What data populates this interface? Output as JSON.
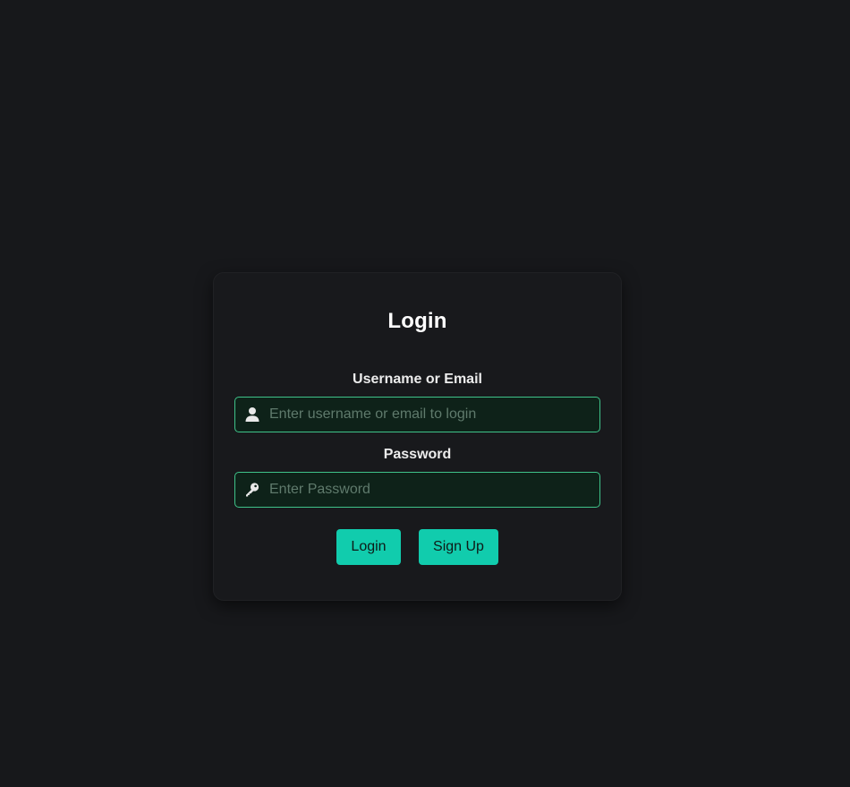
{
  "login_card": {
    "title": "Login",
    "username": {
      "label": "Username or Email",
      "placeholder": "Enter username or email to login",
      "value": "",
      "icon": "user-icon"
    },
    "password": {
      "label": "Password",
      "placeholder": "Enter Password",
      "value": "",
      "icon": "key-icon"
    },
    "buttons": {
      "login_label": "Login",
      "signup_label": "Sign Up"
    }
  },
  "colors": {
    "background": "#17181b",
    "card": "#18191c",
    "accent": "#11ccad",
    "input_border": "#3fc38a",
    "input_background": "#0e2219"
  }
}
